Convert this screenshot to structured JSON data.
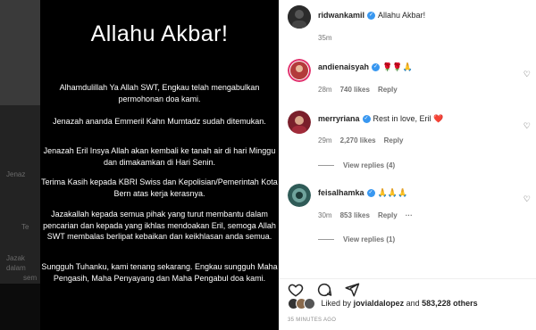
{
  "post": {
    "title": "Allahu Akbar!",
    "paragraphs": [
      "Alhamdulillah Ya Allah SWT, Engkau telah mengabulkan permohonan doa kami.",
      "Jenazah ananda Emmeril Kahn Mumtadz sudah ditemukan.",
      "Jenazah Eril Insya Allah akan kembali ke tanah air di hari Minggu dan dimakamkan di Hari Senin.",
      "Terima Kasih kepada KBRI Swiss dan Kepolisian/Pemerintah Kota Bern atas kerja kerasnya.",
      "Jazakallah kepada semua pihak yang turut membantu dalam pencarian dan kepada yang ikhlas mendoakan Eril, semoga Allah SWT membalas berlipat kebaikan dan keikhlasan anda semua.",
      "Sungguh Tuhanku, kami tenang sekarang. Engkau sungguh Maha Pengasih, Maha Penyayang dan Maha Pengabul doa kami."
    ],
    "ghost_left": [
      "Jenaz",
      "Te",
      "Jazak",
      "dalam",
      "sem"
    ]
  },
  "comments": [
    {
      "user": "ridwankamil",
      "text": "Allahu Akbar!",
      "time": "35m",
      "likes": "",
      "reply": "",
      "avatar_color": "#222222"
    },
    {
      "user": "andienaisyah",
      "text": "🌹🌹🙏",
      "time": "28m",
      "likes": "740 likes",
      "reply": "Reply",
      "avatar_color": "#c23b3b"
    },
    {
      "user": "merryriana",
      "text": "Rest in love, Eril ❤️",
      "time": "29m",
      "likes": "2,270 likes",
      "reply": "Reply",
      "avatar_color": "#7a1f2b",
      "view_replies": "View replies (4)"
    },
    {
      "user": "feisalhamka",
      "text": "🙏🙏🙏",
      "time": "30m",
      "likes": "853 likes",
      "reply": "Reply",
      "avatar_color": "#2f5b57",
      "view_replies": "View replies (1)",
      "more": "···"
    }
  ],
  "liked_by": {
    "prefix": "Liked by",
    "user": "jovialdalopez",
    "joiner": "and",
    "count": "583,228 others"
  },
  "timestamp": "35 MINUTES AGO"
}
